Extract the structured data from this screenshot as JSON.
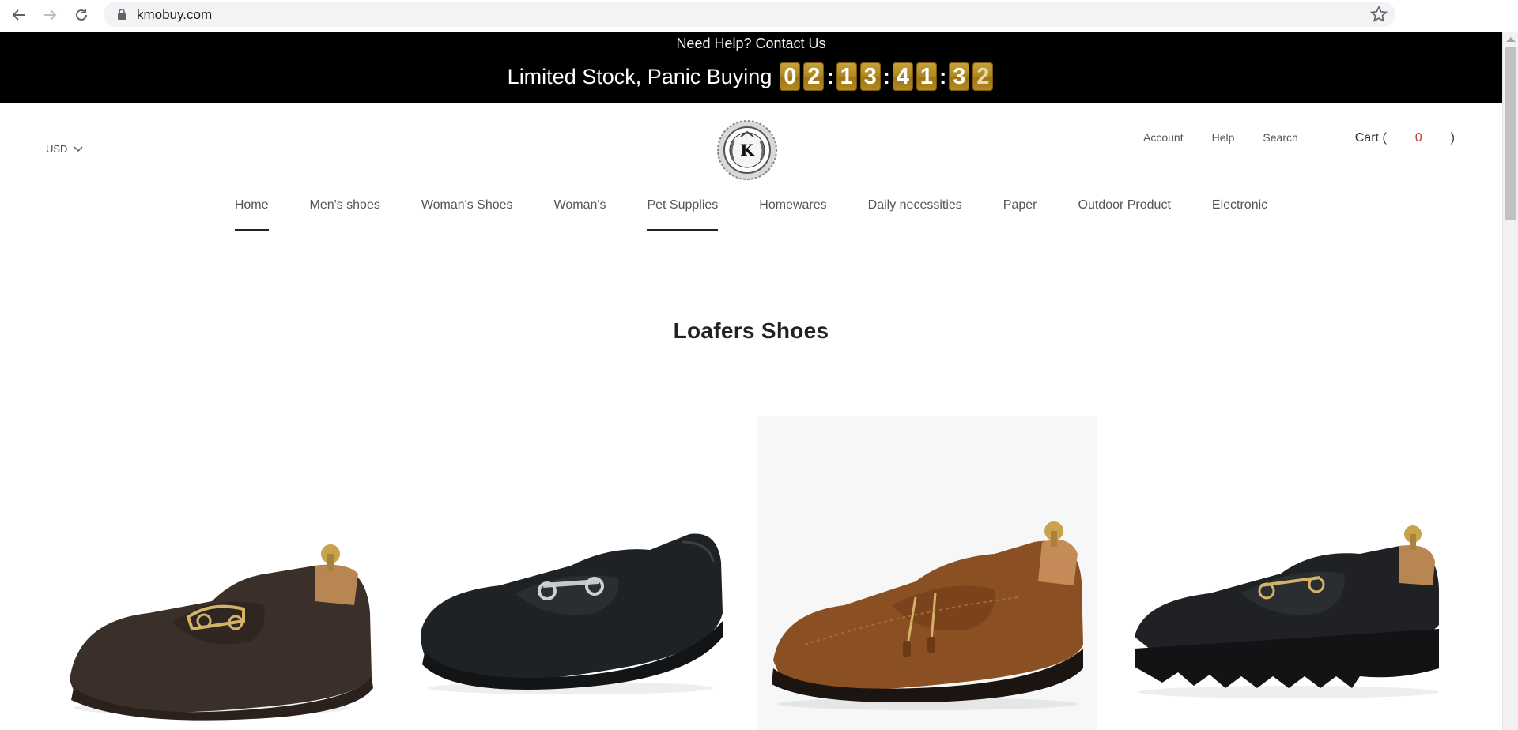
{
  "browser": {
    "url": "kmobuy.com"
  },
  "promo": {
    "help_text": "Need Help? Contact Us",
    "stock_text": "Limited Stock, Panic Buying",
    "countdown": [
      "0",
      "2",
      "1",
      "3",
      "4",
      "1",
      "3",
      "2"
    ]
  },
  "header": {
    "currency": "USD",
    "account": "Account",
    "help": "Help",
    "search": "Search",
    "cart_label": "Cart (",
    "cart_count": "0",
    "cart_close": ")"
  },
  "nav": {
    "items": [
      {
        "label": "Home"
      },
      {
        "label": "Men's shoes"
      },
      {
        "label": "Woman's Shoes"
      },
      {
        "label": "Woman's"
      },
      {
        "label": "Pet Supplies"
      },
      {
        "label": "Homewares"
      },
      {
        "label": "Daily necessities"
      },
      {
        "label": "Paper"
      },
      {
        "label": "Outdoor Product"
      },
      {
        "label": "Electronic"
      }
    ]
  },
  "collection": {
    "title": "Loafers Shoes",
    "products": [
      {
        "image": "dark-brown-horsebit-loafer"
      },
      {
        "image": "black-driving-loafer"
      },
      {
        "image": "brown-tassel-loafer"
      },
      {
        "image": "black-chunky-loafer"
      }
    ]
  },
  "colors": {
    "promo_bg": "#000000",
    "countdown_gold": "#b48a24",
    "cart_count": "#c0392b"
  }
}
